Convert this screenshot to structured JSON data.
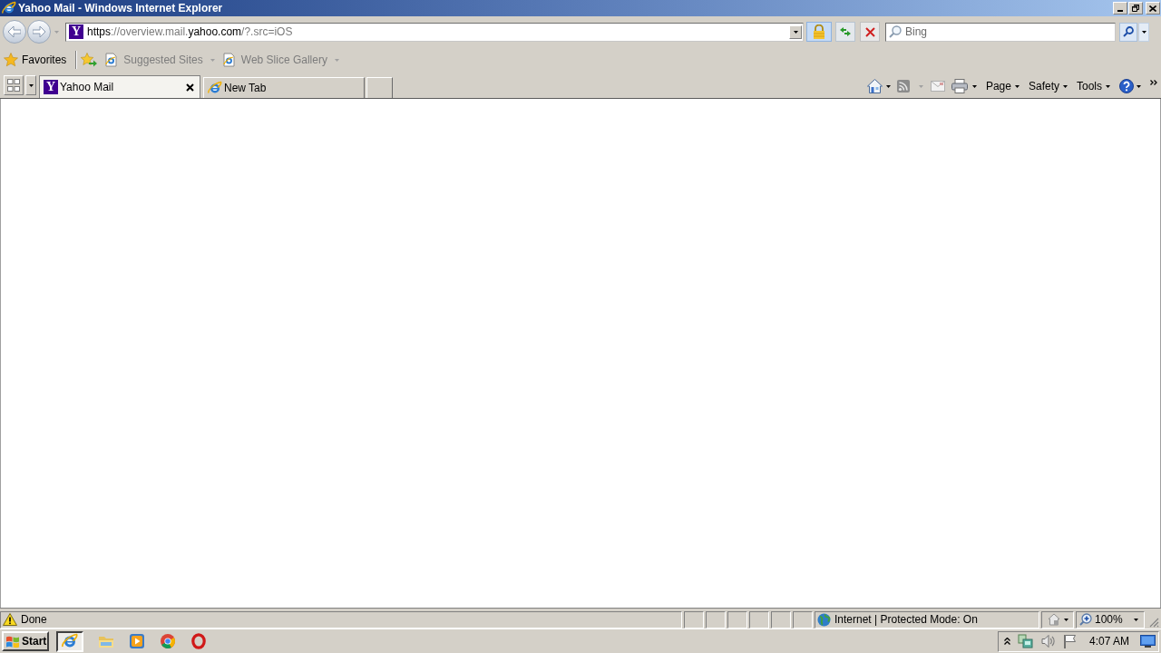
{
  "window": {
    "title": "Yahoo Mail - Windows Internet Explorer"
  },
  "address_bar": {
    "favicon_letter": "Y",
    "url_segments": [
      {
        "text": "https",
        "emphasis": true
      },
      {
        "text": "://overview.mail.",
        "emphasis": false
      },
      {
        "text": "yahoo.com",
        "emphasis": true
      },
      {
        "text": "/?.src=iOS",
        "emphasis": false
      }
    ]
  },
  "search": {
    "placeholder": "Bing"
  },
  "favorites_bar": {
    "label": "Favorites",
    "items": [
      {
        "label": "Suggested Sites",
        "disabled": true
      },
      {
        "label": "Web Slice Gallery",
        "disabled": true
      }
    ]
  },
  "tabs": [
    {
      "label": "Yahoo Mail",
      "favicon_letter": "Y",
      "selected": true
    },
    {
      "label": "New Tab",
      "selected": false
    }
  ],
  "command_bar": {
    "feeds_disabled": true,
    "read_mail_disabled": true,
    "menus": [
      "Page",
      "Safety",
      "Tools"
    ]
  },
  "status_bar": {
    "text": "Done",
    "zone": "Internet | Protected Mode: On",
    "zoom": "100%"
  },
  "taskbar": {
    "start": "Start",
    "items": [
      {
        "kind": "browser",
        "selected": true
      },
      {
        "kind": "folder",
        "selected": false
      },
      {
        "kind": "media",
        "selected": false
      },
      {
        "kind": "ball",
        "selected": false
      },
      {
        "kind": "ring",
        "selected": false
      }
    ],
    "clock": "4:07 AM"
  }
}
